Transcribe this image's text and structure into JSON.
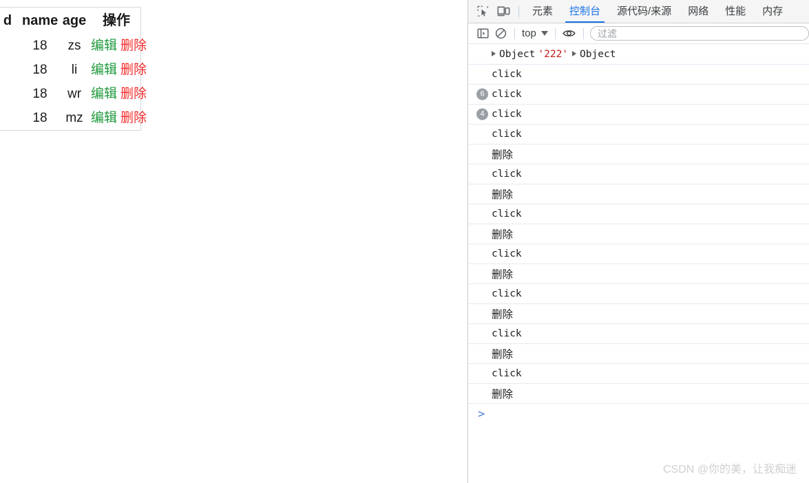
{
  "page": {
    "table": {
      "headers": [
        "",
        "d",
        "name",
        "age",
        "操作"
      ],
      "rows": [
        {
          "check": "",
          "id": "",
          "name": "18",
          "age": "zs",
          "edit": "编辑",
          "delete": "删除"
        },
        {
          "check": "",
          "id": "",
          "name": "18",
          "age": "li",
          "edit": "编辑",
          "delete": "删除"
        },
        {
          "check": "",
          "id": "",
          "name": "18",
          "age": "wr",
          "edit": "编辑",
          "delete": "删除"
        },
        {
          "check": "checked",
          "id": "",
          "name": "18",
          "age": "mz",
          "edit": "编辑",
          "delete": "删除"
        }
      ],
      "colors": {
        "edit": "#1f9a3d",
        "delete": "#f42b2b"
      }
    }
  },
  "devtools": {
    "tabs": [
      {
        "label": "元素",
        "active": false
      },
      {
        "label": "控制台",
        "active": true
      },
      {
        "label": "源代码/来源",
        "active": false
      },
      {
        "label": "网络",
        "active": false
      },
      {
        "label": "性能",
        "active": false
      },
      {
        "label": "内存",
        "active": false
      }
    ],
    "icons": {
      "inspect": "inspect-element-icon",
      "device": "device-toolbar-icon",
      "sidebar": "console-sidebar-icon",
      "clear": "clear-console-icon",
      "eye": "live-expression-eye-icon"
    },
    "toolbar": {
      "context_value": "top",
      "filter_placeholder": "过滤",
      "filter_value": ""
    },
    "accent_color": "#1a73e8",
    "console": {
      "messages": [
        {
          "type": "object",
          "disc1": "▶",
          "obj1": "Object",
          "string": "'222'",
          "disc2": "▶",
          "obj2": "Object",
          "count": ""
        },
        {
          "type": "text",
          "text": "click",
          "font": "mono",
          "count": ""
        },
        {
          "type": "text",
          "text": "click",
          "font": "mono",
          "count": "6"
        },
        {
          "type": "text",
          "text": "click",
          "font": "mono",
          "count": "4"
        },
        {
          "type": "text",
          "text": "click",
          "font": "mono",
          "count": ""
        },
        {
          "type": "text",
          "text": "删除",
          "font": "cjk",
          "count": ""
        },
        {
          "type": "text",
          "text": "click",
          "font": "mono",
          "count": ""
        },
        {
          "type": "text",
          "text": "删除",
          "font": "cjk",
          "count": ""
        },
        {
          "type": "text",
          "text": "click",
          "font": "mono",
          "count": ""
        },
        {
          "type": "text",
          "text": "删除",
          "font": "cjk",
          "count": ""
        },
        {
          "type": "text",
          "text": "click",
          "font": "mono",
          "count": ""
        },
        {
          "type": "text",
          "text": "删除",
          "font": "cjk",
          "count": ""
        },
        {
          "type": "text",
          "text": "click",
          "font": "mono",
          "count": ""
        },
        {
          "type": "text",
          "text": "删除",
          "font": "cjk",
          "count": ""
        },
        {
          "type": "text",
          "text": "click",
          "font": "mono",
          "count": ""
        },
        {
          "type": "text",
          "text": "删除",
          "font": "cjk",
          "count": ""
        },
        {
          "type": "text",
          "text": "click",
          "font": "mono",
          "count": ""
        },
        {
          "type": "text",
          "text": "删除",
          "font": "cjk",
          "count": ""
        }
      ],
      "prompt": ">"
    }
  },
  "watermark": "CSDN @你的美，让我痴迷"
}
